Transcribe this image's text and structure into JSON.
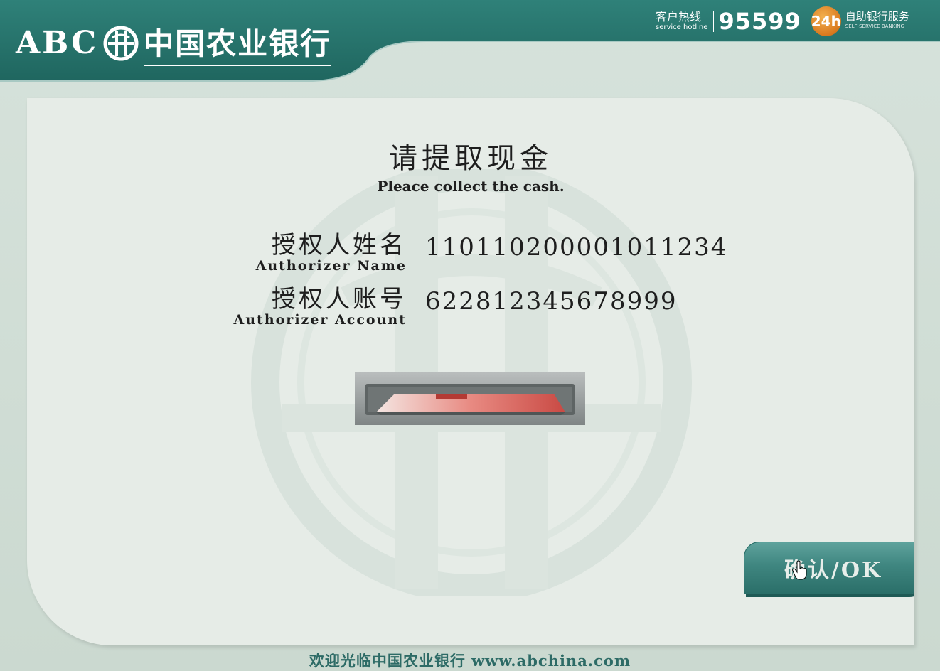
{
  "header": {
    "logo_abc": "ABC",
    "logo_cn": "中国农业银行",
    "hotline_cn": "客户热线",
    "hotline_en": "service hotline",
    "hotline_number": "95599",
    "badge_24h": "24h",
    "self_service_cn": "自助银行服务",
    "self_service_en": "SELF-SERVICE BANKING"
  },
  "main": {
    "title_cn": "请提取现金",
    "title_en": "Pleace collect the cash.",
    "fields": [
      {
        "label_cn": "授权人姓名",
        "label_en": "Authorizer Name",
        "value": "110110200001011234"
      },
      {
        "label_cn": "授权人账号",
        "label_en": "Authorizer Account",
        "value": "622812345678999"
      }
    ],
    "ok_label": "确认/OK"
  },
  "footer": {
    "text": "欢迎光临中国农业银行 www.abchina.com"
  },
  "colors": {
    "brand_green": "#2c7a72",
    "panel_bg": "#e6ece7",
    "page_bg": "#cfdcd4",
    "footer_text": "#2d6b66"
  },
  "icons": {
    "logo": "abc-coin-emblem-icon",
    "badge": "24h-clock-icon",
    "cursor": "hand-pointer-icon",
    "cash": "cash-slot-icon"
  }
}
